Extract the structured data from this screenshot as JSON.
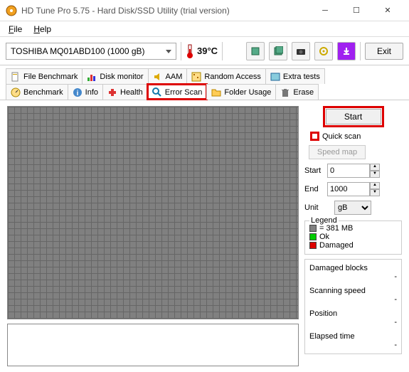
{
  "window": {
    "title": "HD Tune Pro 5.75 - Hard Disk/SSD Utility (trial version)"
  },
  "menu": {
    "file": "File",
    "help": "Help"
  },
  "toolbar": {
    "drive": "TOSHIBA MQ01ABD100 (1000 gB)",
    "temp": "39°C",
    "exit": "Exit"
  },
  "tabs": {
    "row1": [
      "File Benchmark",
      "Disk monitor",
      "AAM",
      "Random Access",
      "Extra tests"
    ],
    "row2": [
      "Benchmark",
      "Info",
      "Health",
      "Error Scan",
      "Folder Usage",
      "Erase"
    ]
  },
  "panel": {
    "start": "Start",
    "quickscan": "Quick scan",
    "speedmap": "Speed map",
    "start_label": "Start",
    "start_val": "0",
    "end_label": "End",
    "end_val": "1000",
    "unit_label": "Unit",
    "unit_val": "gB",
    "legend_title": "Legend",
    "legend_size": "= 381 MB",
    "legend_ok": "Ok",
    "legend_dmg": "Damaged",
    "status": {
      "damaged": "Damaged blocks",
      "damaged_val": "-",
      "speed": "Scanning speed",
      "speed_val": "-",
      "pos": "Position",
      "pos_val": "-",
      "elapsed": "Elapsed time",
      "elapsed_val": "-"
    }
  }
}
